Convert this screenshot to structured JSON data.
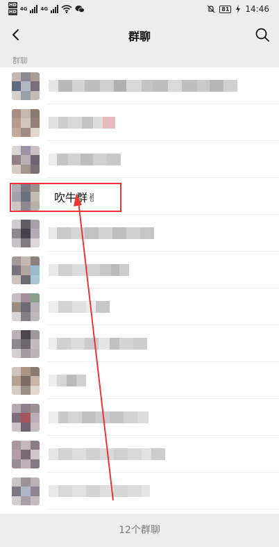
{
  "status": {
    "hd1": "HD",
    "hd2": "HD",
    "net1": "4G",
    "net2": "4G",
    "battery": "81",
    "time": "14:46"
  },
  "nav": {
    "title": "群聊",
    "back_icon": "back-arrow-icon",
    "search_icon": "search-icon"
  },
  "section_label": "群聊",
  "groups": [
    {
      "name": null
    },
    {
      "name": null
    },
    {
      "name": null
    },
    {
      "name": "吹牛群✌"
    },
    {
      "name": null
    },
    {
      "name": null
    },
    {
      "name": null
    },
    {
      "name": null
    },
    {
      "name": null
    },
    {
      "name": null
    },
    {
      "name": null
    },
    {
      "name": null
    }
  ],
  "footer": {
    "count_label": "12个群聊"
  },
  "colors": {
    "background": "#ededed",
    "list_bg": "#ffffff",
    "annotation_red": "#ee3333"
  }
}
